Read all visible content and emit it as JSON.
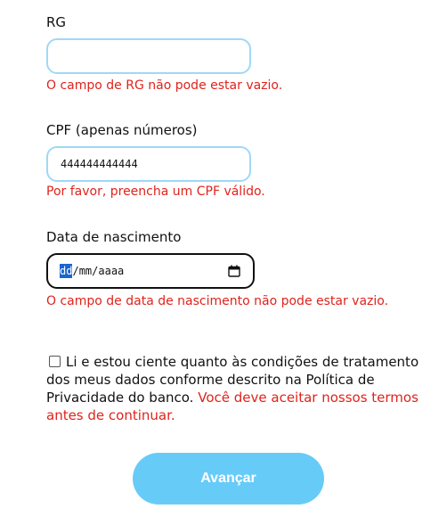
{
  "rg": {
    "label": "RG",
    "value": "",
    "error": "O campo de RG não pode estar vazio."
  },
  "cpf": {
    "label": "CPF (apenas números)",
    "value": "444444444444",
    "error": "Por favor, preencha um CPF válido."
  },
  "birth": {
    "label": "Data de nascimento",
    "day": "dd",
    "sep1": "/",
    "month": "mm",
    "sep2": "/",
    "year": "aaaa",
    "error": "O campo de data de nascimento não pode estar vazio."
  },
  "consent": {
    "text": "Li e estou ciente quanto às condições de tratamento dos meus dados conforme descrito na Política de Privacidade do banco.",
    "error": "Você deve aceitar nossos termos antes de continuar.",
    "checked": false
  },
  "submit": {
    "label": "Avançar"
  },
  "colors": {
    "accent": "#67cbf8",
    "input_border": "#9fd8f7",
    "error": "#e0231c"
  },
  "icons": {
    "calendar": "calendar-icon"
  }
}
